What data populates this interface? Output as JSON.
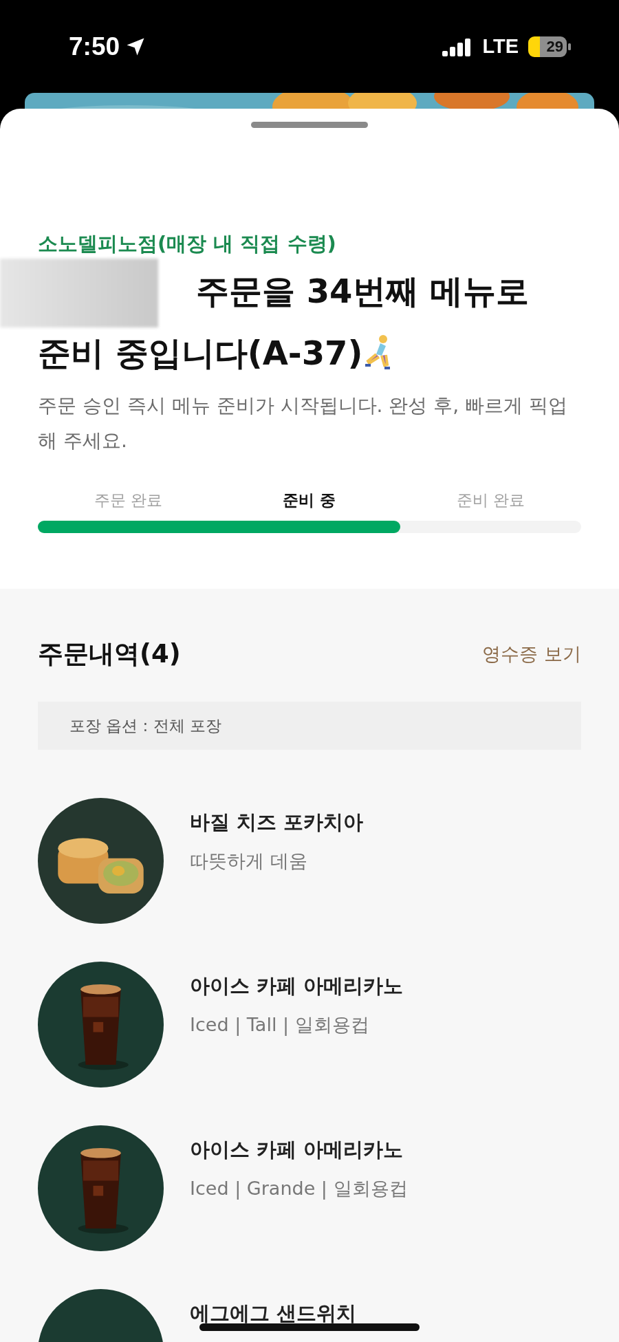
{
  "status_bar": {
    "time": "7:50",
    "network": "LTE",
    "battery": "29"
  },
  "order": {
    "store": "소노델피노점(매장 내 직접 수령)",
    "title_lines": [
      "주문을 34번째 메뉴로",
      "준비 중입니다(A-37)"
    ],
    "description": "주문 승인 즉시 메뉴 준비가 시작됩니다. 완성 후, 빠르게 픽업해 주세요.",
    "steps": [
      {
        "label": "주문 완료",
        "selected": false
      },
      {
        "label": "준비 중",
        "selected": true
      },
      {
        "label": "준비 완료",
        "selected": false
      }
    ],
    "progress": {
      "level": 0.667
    }
  },
  "history": {
    "title": "주문내역(4)",
    "receipt_link": "영수증 보기",
    "packaging": "포장 옵션 : 전체 포장",
    "items": [
      {
        "name": "바질 치즈 포카치아",
        "option": "따뜻하게 데움"
      },
      {
        "name": "아이스 카페 아메리카노",
        "option": "Iced | Tall | 일회용컵"
      },
      {
        "name": "아이스 카페 아메리카노",
        "option": "Iced | Grande | 일회용컵"
      },
      {
        "name": "에그에그 샌드위치"
      }
    ]
  }
}
